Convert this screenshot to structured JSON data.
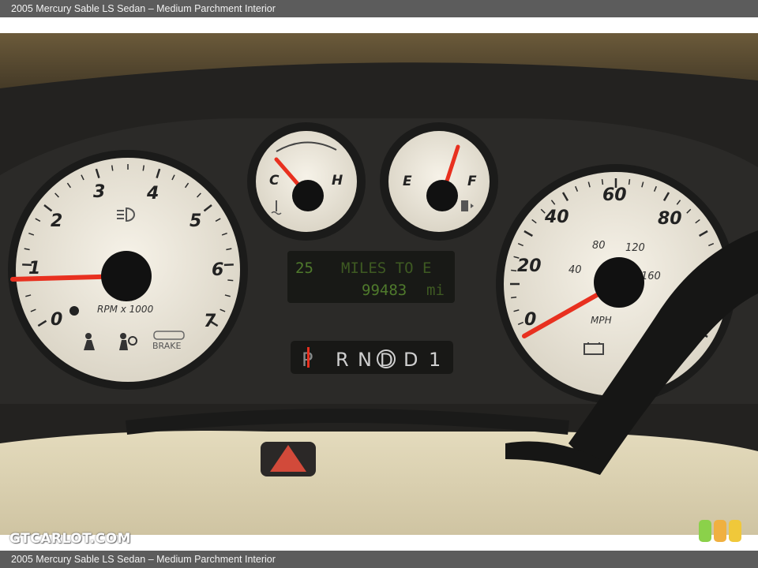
{
  "header": {
    "caption": "2005 Mercury Sable LS Sedan – Medium Parchment Interior"
  },
  "footer": {
    "caption": "2005 Mercury Sable LS Sedan – Medium Parchment Interior"
  },
  "watermark": {
    "text": "GTCARLOT.COM"
  },
  "tachometer": {
    "numbers": [
      "0",
      "1",
      "2",
      "3",
      "4",
      "5",
      "6",
      "7"
    ],
    "unit_label": "RPM x 1000",
    "brake_label": "BRAKE",
    "needle_value": 1.0
  },
  "temp_gauge": {
    "cold_label": "C",
    "hot_label": "H"
  },
  "fuel_gauge": {
    "empty_label": "E",
    "full_label": "F"
  },
  "speedometer": {
    "mph_numbers": [
      "0",
      "20",
      "40",
      "60",
      "80"
    ],
    "kmh_numbers": [
      "40",
      "80",
      "120",
      "160"
    ],
    "unit_label": "MPH",
    "needle_value": 0
  },
  "odometer": {
    "line1_range": "25",
    "line1_text": "MILES TO E",
    "line2_odo": "99483",
    "line2_unit": "mi"
  },
  "gear_selector": {
    "positions": [
      "P",
      "R",
      "N",
      "D",
      "D",
      "1"
    ]
  },
  "colors": {
    "needle": "#e8301f",
    "dial_face": "#ede8dc",
    "lcd_text": "#4e6a2c",
    "dash": "#1e1e1c",
    "trim": "#d8ceac"
  }
}
